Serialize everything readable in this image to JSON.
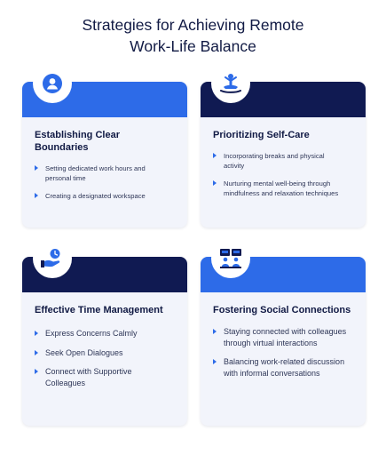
{
  "title": {
    "line1": "Strategies for Achieving Remote",
    "line2": "Work-Life Balance"
  },
  "colors": {
    "accent_blue": "#2d6be8",
    "navy": "#101a52",
    "card_bg": "#f2f4fb",
    "title_text": "#111a44"
  },
  "cards": [
    {
      "title_line1": "Establishing Clear",
      "title_line2": "Boundaries",
      "icon": "person-icon",
      "bullets": [
        "Setting dedicated work hours and personal time",
        "Creating a designated workspace"
      ]
    },
    {
      "title_line1": "Prioritizing Self-Care",
      "icon": "meditation-icon",
      "bullets": [
        "Incorporating breaks and physical activity",
        "Nurturing mental well-being through mindfulness and relaxation techniques"
      ]
    },
    {
      "title_line1": "Effective Time Management",
      "icon": "time-money-icon",
      "bullets": [
        "Express Concerns Calmly",
        "Seek Open Dialogues",
        "Connect with Supportive Colleagues"
      ]
    },
    {
      "title_line1": "Fostering Social Connections",
      "icon": "people-meeting-icon",
      "bullets": [
        "Staying connected with colleagues through virtual interactions",
        "Balancing work-related discussion with informal conversations"
      ]
    }
  ]
}
